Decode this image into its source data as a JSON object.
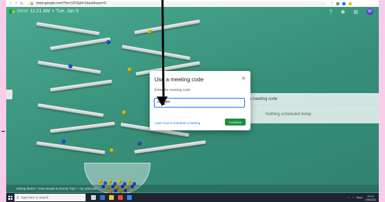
{
  "browser": {
    "url": "meet.google.com/?hs=197&pli=1&authuser=0",
    "nav_icons": [
      "back-icon",
      "forward-icon",
      "reload-icon"
    ],
    "tray_icons": [
      "star-icon",
      "extension-icon",
      "profile-icon"
    ]
  },
  "meet": {
    "brand": "Meet",
    "time": "11:21 AM",
    "date": "Tue, Jan 5",
    "avatar_initial": "W",
    "header_icons": [
      "help-icon",
      "settings-icon",
      "apps-icon"
    ]
  },
  "side_panel": {
    "join_text": "se a meeting code",
    "empty_text": "Nothing scheduled today"
  },
  "dialog": {
    "title": "Use a meeting code",
    "subtitle": "Enter the meeting code",
    "input_value": "sedwjm",
    "learn_link": "Learn how to schedule a meeting",
    "continue_label": "Continue"
  },
  "caption": {
    "text": "Visiting Marbs + Eats Beads & Gravity Toys — by unknown"
  },
  "taskbar": {
    "search_placeholder": "Type here to search",
    "time": "11:21",
    "date": "1/5/2021",
    "lang": "ENG"
  },
  "colors": {
    "scene_green": "#3c9b83",
    "dialog_accent": "#1a73e8",
    "continue_green": "#1e8e3e",
    "page_pink": "#f7cdea"
  }
}
